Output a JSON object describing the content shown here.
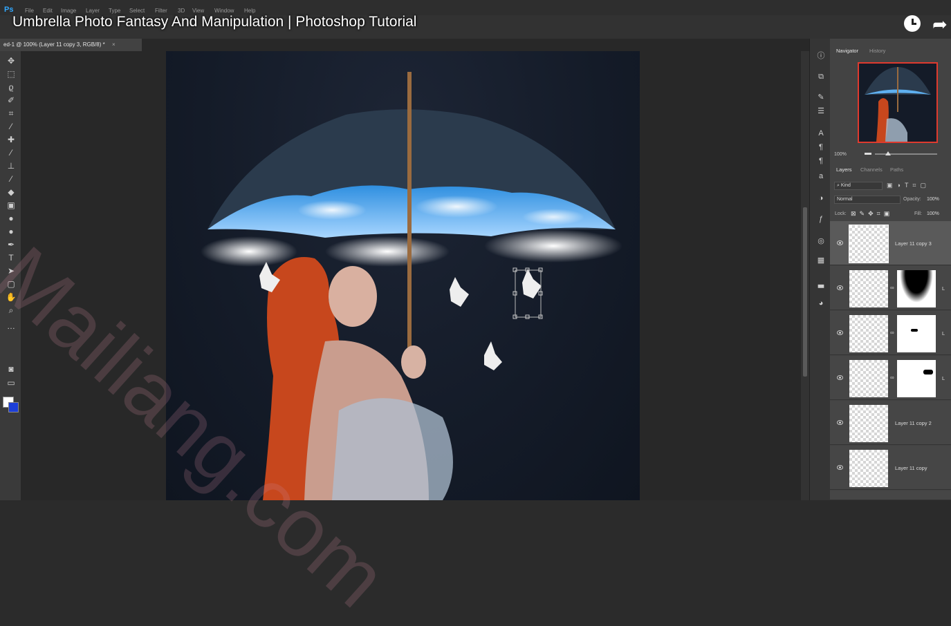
{
  "app": {
    "logo": "Ps"
  },
  "menu": [
    "File",
    "Edit",
    "Image",
    "Layer",
    "Type",
    "Select",
    "Filter",
    "3D",
    "View",
    "Window",
    "Help"
  ],
  "video": {
    "title": "Umbrella Photo Fantasy And Manipulation | Photoshop Tutorial"
  },
  "document": {
    "tab_label": "ed-1 @ 100% (Layer 11 copy 3, RGB/8) *",
    "close": "×"
  },
  "colors": {
    "foreground": "#ffffff",
    "background": "#1d3fd8",
    "accent": "#e03a2e"
  },
  "navigator": {
    "tabs": [
      "Navigator",
      "History"
    ],
    "zoom": "100%"
  },
  "layers_panel": {
    "tabs": [
      "Layers",
      "Channels",
      "Paths"
    ],
    "filter": "Kind",
    "blend_mode": "Normal",
    "opacity_label": "Opacity:",
    "opacity": "100%",
    "lock_label": "Lock:",
    "fill_label": "Fill:",
    "fill": "100%",
    "layers": [
      {
        "name": "Layer 11 copy 3"
      },
      {
        "name": "L"
      },
      {
        "name": "L"
      },
      {
        "name": "L"
      },
      {
        "name": "Layer 11 copy 2"
      },
      {
        "name": "Layer 11 copy"
      }
    ]
  },
  "tools": [
    "move-icon",
    "marquee-icon",
    "lasso-icon",
    "quick-select-icon",
    "crop-icon",
    "eyedropper-icon",
    "healing-icon",
    "brush-icon",
    "stamp-icon",
    "history-brush-icon",
    "eraser-icon",
    "gradient-icon",
    "blur-icon",
    "dodge-icon",
    "pen-icon",
    "type-icon",
    "path-select-icon",
    "shape-icon",
    "hand-icon",
    "zoom-icon",
    "more-icon"
  ],
  "watermark": "Mailiang.com"
}
